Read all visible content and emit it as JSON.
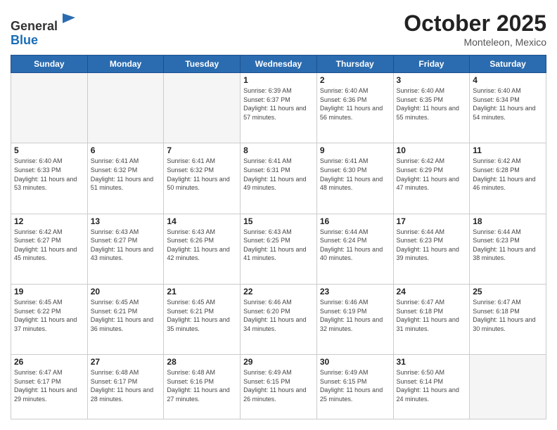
{
  "header": {
    "logo_general": "General",
    "logo_blue": "Blue",
    "month_title": "October 2025",
    "location": "Monteleon, Mexico"
  },
  "days_of_week": [
    "Sunday",
    "Monday",
    "Tuesday",
    "Wednesday",
    "Thursday",
    "Friday",
    "Saturday"
  ],
  "weeks": [
    [
      {
        "day": "",
        "sunrise": "",
        "sunset": "",
        "daylight": "",
        "empty": true
      },
      {
        "day": "",
        "sunrise": "",
        "sunset": "",
        "daylight": "",
        "empty": true
      },
      {
        "day": "",
        "sunrise": "",
        "sunset": "",
        "daylight": "",
        "empty": true
      },
      {
        "day": "1",
        "sunrise": "Sunrise: 6:39 AM",
        "sunset": "Sunset: 6:37 PM",
        "daylight": "Daylight: 11 hours and 57 minutes.",
        "empty": false
      },
      {
        "day": "2",
        "sunrise": "Sunrise: 6:40 AM",
        "sunset": "Sunset: 6:36 PM",
        "daylight": "Daylight: 11 hours and 56 minutes.",
        "empty": false
      },
      {
        "day": "3",
        "sunrise": "Sunrise: 6:40 AM",
        "sunset": "Sunset: 6:35 PM",
        "daylight": "Daylight: 11 hours and 55 minutes.",
        "empty": false
      },
      {
        "day": "4",
        "sunrise": "Sunrise: 6:40 AM",
        "sunset": "Sunset: 6:34 PM",
        "daylight": "Daylight: 11 hours and 54 minutes.",
        "empty": false
      }
    ],
    [
      {
        "day": "5",
        "sunrise": "Sunrise: 6:40 AM",
        "sunset": "Sunset: 6:33 PM",
        "daylight": "Daylight: 11 hours and 53 minutes.",
        "empty": false
      },
      {
        "day": "6",
        "sunrise": "Sunrise: 6:41 AM",
        "sunset": "Sunset: 6:32 PM",
        "daylight": "Daylight: 11 hours and 51 minutes.",
        "empty": false
      },
      {
        "day": "7",
        "sunrise": "Sunrise: 6:41 AM",
        "sunset": "Sunset: 6:32 PM",
        "daylight": "Daylight: 11 hours and 50 minutes.",
        "empty": false
      },
      {
        "day": "8",
        "sunrise": "Sunrise: 6:41 AM",
        "sunset": "Sunset: 6:31 PM",
        "daylight": "Daylight: 11 hours and 49 minutes.",
        "empty": false
      },
      {
        "day": "9",
        "sunrise": "Sunrise: 6:41 AM",
        "sunset": "Sunset: 6:30 PM",
        "daylight": "Daylight: 11 hours and 48 minutes.",
        "empty": false
      },
      {
        "day": "10",
        "sunrise": "Sunrise: 6:42 AM",
        "sunset": "Sunset: 6:29 PM",
        "daylight": "Daylight: 11 hours and 47 minutes.",
        "empty": false
      },
      {
        "day": "11",
        "sunrise": "Sunrise: 6:42 AM",
        "sunset": "Sunset: 6:28 PM",
        "daylight": "Daylight: 11 hours and 46 minutes.",
        "empty": false
      }
    ],
    [
      {
        "day": "12",
        "sunrise": "Sunrise: 6:42 AM",
        "sunset": "Sunset: 6:27 PM",
        "daylight": "Daylight: 11 hours and 45 minutes.",
        "empty": false
      },
      {
        "day": "13",
        "sunrise": "Sunrise: 6:43 AM",
        "sunset": "Sunset: 6:27 PM",
        "daylight": "Daylight: 11 hours and 43 minutes.",
        "empty": false
      },
      {
        "day": "14",
        "sunrise": "Sunrise: 6:43 AM",
        "sunset": "Sunset: 6:26 PM",
        "daylight": "Daylight: 11 hours and 42 minutes.",
        "empty": false
      },
      {
        "day": "15",
        "sunrise": "Sunrise: 6:43 AM",
        "sunset": "Sunset: 6:25 PM",
        "daylight": "Daylight: 11 hours and 41 minutes.",
        "empty": false
      },
      {
        "day": "16",
        "sunrise": "Sunrise: 6:44 AM",
        "sunset": "Sunset: 6:24 PM",
        "daylight": "Daylight: 11 hours and 40 minutes.",
        "empty": false
      },
      {
        "day": "17",
        "sunrise": "Sunrise: 6:44 AM",
        "sunset": "Sunset: 6:23 PM",
        "daylight": "Daylight: 11 hours and 39 minutes.",
        "empty": false
      },
      {
        "day": "18",
        "sunrise": "Sunrise: 6:44 AM",
        "sunset": "Sunset: 6:23 PM",
        "daylight": "Daylight: 11 hours and 38 minutes.",
        "empty": false
      }
    ],
    [
      {
        "day": "19",
        "sunrise": "Sunrise: 6:45 AM",
        "sunset": "Sunset: 6:22 PM",
        "daylight": "Daylight: 11 hours and 37 minutes.",
        "empty": false
      },
      {
        "day": "20",
        "sunrise": "Sunrise: 6:45 AM",
        "sunset": "Sunset: 6:21 PM",
        "daylight": "Daylight: 11 hours and 36 minutes.",
        "empty": false
      },
      {
        "day": "21",
        "sunrise": "Sunrise: 6:45 AM",
        "sunset": "Sunset: 6:21 PM",
        "daylight": "Daylight: 11 hours and 35 minutes.",
        "empty": false
      },
      {
        "day": "22",
        "sunrise": "Sunrise: 6:46 AM",
        "sunset": "Sunset: 6:20 PM",
        "daylight": "Daylight: 11 hours and 34 minutes.",
        "empty": false
      },
      {
        "day": "23",
        "sunrise": "Sunrise: 6:46 AM",
        "sunset": "Sunset: 6:19 PM",
        "daylight": "Daylight: 11 hours and 32 minutes.",
        "empty": false
      },
      {
        "day": "24",
        "sunrise": "Sunrise: 6:47 AM",
        "sunset": "Sunset: 6:18 PM",
        "daylight": "Daylight: 11 hours and 31 minutes.",
        "empty": false
      },
      {
        "day": "25",
        "sunrise": "Sunrise: 6:47 AM",
        "sunset": "Sunset: 6:18 PM",
        "daylight": "Daylight: 11 hours and 30 minutes.",
        "empty": false
      }
    ],
    [
      {
        "day": "26",
        "sunrise": "Sunrise: 6:47 AM",
        "sunset": "Sunset: 6:17 PM",
        "daylight": "Daylight: 11 hours and 29 minutes.",
        "empty": false
      },
      {
        "day": "27",
        "sunrise": "Sunrise: 6:48 AM",
        "sunset": "Sunset: 6:17 PM",
        "daylight": "Daylight: 11 hours and 28 minutes.",
        "empty": false
      },
      {
        "day": "28",
        "sunrise": "Sunrise: 6:48 AM",
        "sunset": "Sunset: 6:16 PM",
        "daylight": "Daylight: 11 hours and 27 minutes.",
        "empty": false
      },
      {
        "day": "29",
        "sunrise": "Sunrise: 6:49 AM",
        "sunset": "Sunset: 6:15 PM",
        "daylight": "Daylight: 11 hours and 26 minutes.",
        "empty": false
      },
      {
        "day": "30",
        "sunrise": "Sunrise: 6:49 AM",
        "sunset": "Sunset: 6:15 PM",
        "daylight": "Daylight: 11 hours and 25 minutes.",
        "empty": false
      },
      {
        "day": "31",
        "sunrise": "Sunrise: 6:50 AM",
        "sunset": "Sunset: 6:14 PM",
        "daylight": "Daylight: 11 hours and 24 minutes.",
        "empty": false
      },
      {
        "day": "",
        "sunrise": "",
        "sunset": "",
        "daylight": "",
        "empty": true
      }
    ]
  ]
}
